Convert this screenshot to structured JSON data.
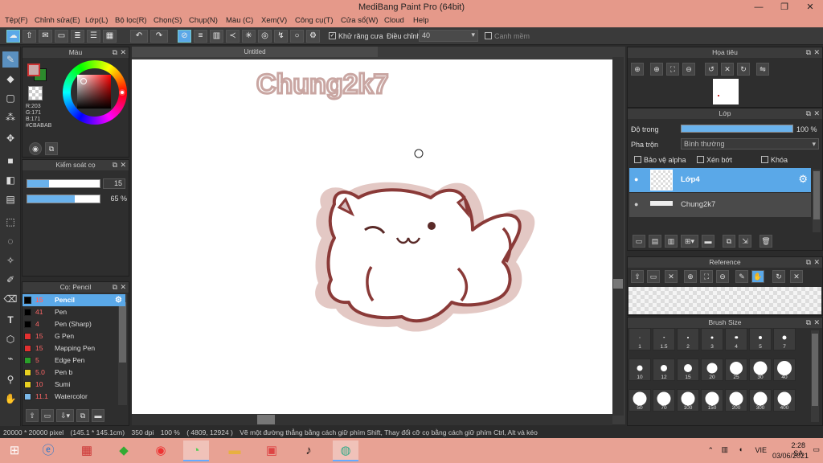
{
  "window": {
    "title": "MediBang Paint Pro (64bit)",
    "minimize": "—",
    "maximize": "❐",
    "close": "✕"
  },
  "menu": [
    "Tệp(F)",
    "Chỉnh sửa(E)",
    "Lớp(L)",
    "Bộ lọc(R)",
    "Chọn(S)",
    "Chụp(N)",
    "Màu (C)",
    "Xem(V)",
    "Công cụ(T)",
    "Cửa sổ(W)",
    "Cloud",
    "Help"
  ],
  "toolbar": {
    "antialias_label": "Khử răng cưa",
    "adjust_label": "Điều chỉnh",
    "adjust_value": "40",
    "snap_label": "Canh mềm",
    "check": "✓"
  },
  "color_panel": {
    "title": "Màu",
    "r": "R:203",
    "g": "G:171",
    "b": "B:171",
    "hex": "#CBABAB",
    "primary_color": "#CBABAB",
    "secondary_color": "#2c8a2c"
  },
  "size_panel": {
    "title": "Kiểm soát cọ",
    "size_value": "15",
    "opacity_value": "65 %",
    "size_fill": 0.3,
    "opacity_fill": 0.65
  },
  "brush_panel": {
    "title": "Cọ: Pencil",
    "items": [
      {
        "size": "15",
        "name": "Pencil",
        "color": "#000000",
        "selected": true
      },
      {
        "size": "41",
        "name": "Pen",
        "color": "#000000"
      },
      {
        "size": "4",
        "name": "Pen (Sharp)",
        "color": "#000000"
      },
      {
        "size": "15",
        "name": "G Pen",
        "color": "#e23030"
      },
      {
        "size": "15",
        "name": "Mapping Pen",
        "color": "#e23030"
      },
      {
        "size": "5",
        "name": "Edge Pen",
        "color": "#2aa02a"
      },
      {
        "size": "5.0",
        "name": "Pen b",
        "color": "#e8d020"
      },
      {
        "size": "10",
        "name": "Sumi",
        "color": "#e8d020"
      },
      {
        "size": "11.1",
        "name": "Watercolor",
        "color": "#7ab8e8"
      }
    ]
  },
  "document": {
    "tab": "Untitled",
    "signature": "Chung2k7"
  },
  "navigator": {
    "title": "Họa tiêu"
  },
  "layers": {
    "title": "Lớp",
    "opacity_label": "Độ trong",
    "opacity_value": "100 %",
    "blend_label": "Pha trộn",
    "blend_value": "Bình thường",
    "protect_alpha": "Bảo vệ alpha",
    "clipping": "Xén bớt",
    "lock": "Khóa",
    "items": [
      {
        "name": "Lớp4",
        "selected": true
      },
      {
        "name": "Chung2k7",
        "selected": false
      }
    ]
  },
  "reference": {
    "title": "Reference"
  },
  "brush_size": {
    "title": "Brush Size",
    "sizes": [
      "1",
      "1.5",
      "2",
      "3",
      "4",
      "5",
      "7",
      "10",
      "12",
      "15",
      "20",
      "25",
      "30",
      "40",
      "50",
      "70",
      "100",
      "150",
      "200",
      "300",
      "400"
    ]
  },
  "status": {
    "canvas_size": "20000 * 20000 pixel",
    "physical": "(145.1 * 145.1cm)",
    "dpi": "350 dpi",
    "zoom": "100 %",
    "coords": "( 4809, 12924 )",
    "hint": "Vẽ một đường thẳng bằng cách giữ phím Shift, Thay đổi cỡ cọ bằng cách giữ phím Ctrl, Alt và kéo"
  },
  "taskbar": {
    "lang": "VIE",
    "time": "2:28 SA",
    "date": "03/06/2021"
  }
}
